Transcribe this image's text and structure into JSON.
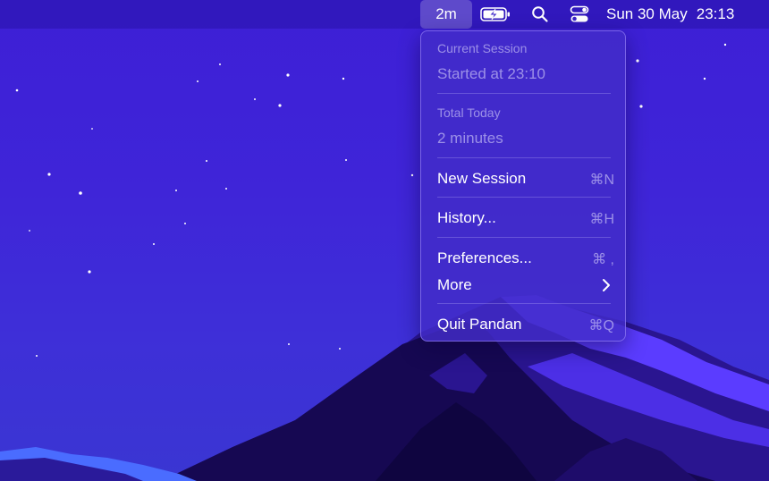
{
  "menubar": {
    "timer_label": "2m",
    "battery_icon": "battery-charging-icon",
    "search_icon": "search-icon",
    "control_center_icon": "control-center-icon",
    "date": "Sun 30 May",
    "time": "23:13"
  },
  "menu": {
    "current_session": {
      "label": "Current Session",
      "value": "Started at 23:10"
    },
    "total_today": {
      "label": "Total Today",
      "value": "2 minutes"
    },
    "items": [
      {
        "label": "New Session",
        "shortcut": "⌘N"
      },
      {
        "label": "History...",
        "shortcut": "⌘H"
      },
      {
        "label": "Preferences...",
        "shortcut": "⌘ ,"
      },
      {
        "label": "More",
        "shortcut": ""
      },
      {
        "label": "Quit Pandan",
        "shortcut": "⌘Q"
      }
    ]
  },
  "colors": {
    "wallpaper_sky": "#3d22d6",
    "mountain_dark": "#1a0a5e",
    "mountain_light": "#5a3bff"
  }
}
